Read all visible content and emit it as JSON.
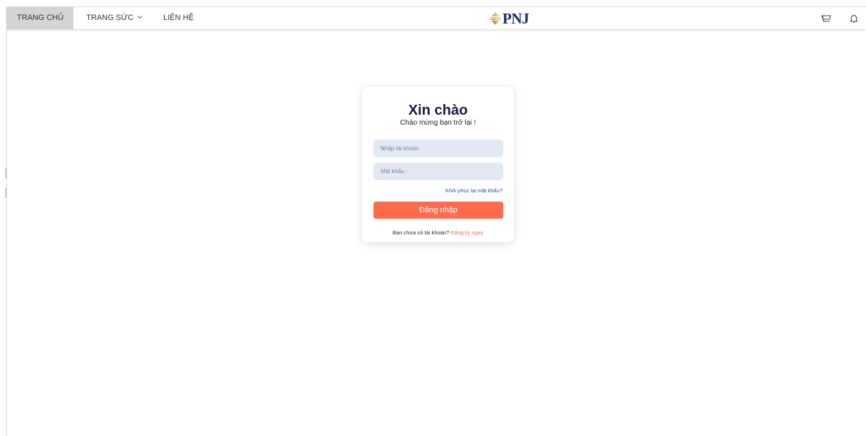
{
  "nav": {
    "home": "TRANG CHỦ",
    "jewelry": "TRANG SỨC",
    "contact": "LIÊN HỆ"
  },
  "logo": {
    "text": "PNJ"
  },
  "icons": {
    "jewelry_dropdown": "chevron-down-icon",
    "cart": "cart-icon",
    "notifications": "bell-icon",
    "logo_mark": "diamond-logo-icon"
  },
  "login": {
    "title": "Xin chào",
    "subtitle": "Chào mừng bạn trở lại !",
    "username_placeholder": "Nhập tài khoản",
    "password_placeholder": "Mật khẩu",
    "username_value": "",
    "password_value": "",
    "forgot_password": "Khôi phục lại mật khẩu?",
    "submit": "Đăng nhập",
    "no_account": "Bạn chưa có tài khoản?",
    "register": "Đăng ký ngay"
  },
  "colors": {
    "accent": "#fd6a4c",
    "brand_navy": "#1b2a6b",
    "input_bg": "#e2e8f4",
    "link_blue": "#2a4fa8",
    "active_tab_bg": "#d4d4d4"
  }
}
